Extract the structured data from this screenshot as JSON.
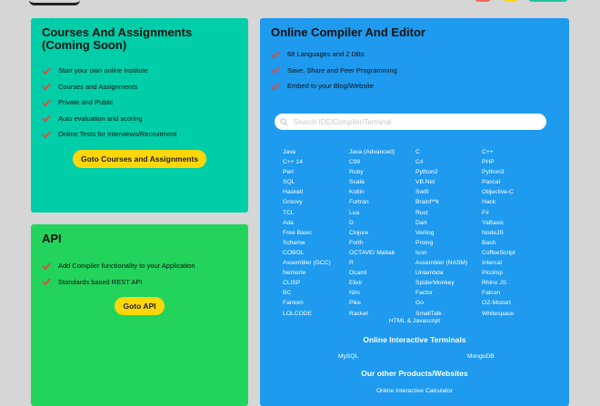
{
  "colors": {
    "page_bg": "#d6d6d6",
    "courses_card": "#00cea8",
    "api_card": "#22d45c",
    "compiler_card": "#1e9aee",
    "button_yellow": "#ffd60a",
    "check_red": "#e8453c",
    "header_red": "#f0685d",
    "header_yellow": "#ffd60a",
    "header_green": "#1fc79a"
  },
  "courses": {
    "title": "Courses And Assignments (Coming Soon)",
    "items": [
      "Start your own online Institute",
      "Courses and Assignments",
      "Private and Public",
      "Auto evaluation and scoring",
      "Online Tests for Interviews/Recruitment"
    ],
    "button": "Goto Courses and Assignments"
  },
  "api": {
    "title": "API",
    "items": [
      "Add Compiler functionality to your Application",
      "Standards based REST API"
    ],
    "button": "Goto API"
  },
  "compiler": {
    "title": "Online Compiler And Editor",
    "items": [
      "68 Languages and 2 DBs",
      "Save, Share and Peer Programming",
      "Embed to your Blog/Website"
    ],
    "search_placeholder": "Search IDE/Compiler/Terminal",
    "languages": [
      "Java",
      "Java (Advanced)",
      "C",
      "C++",
      "C++ 14",
      "C99",
      "C#",
      "PHP",
      "Perl",
      "Ruby",
      "Python2",
      "Python3",
      "SQL",
      "Scala",
      "VB.Net",
      "Pascal",
      "Haskell",
      "Kotlin",
      "Swift",
      "Objective-C",
      "Groovy",
      "Fortran",
      "Brainf**k",
      "Hack",
      "TCL",
      "Lua",
      "Rust",
      "F#",
      "Ada",
      "D",
      "Dart",
      "YaBasic",
      "Free Basic",
      "Clojure",
      "Verilog",
      "NodeJS",
      "Scheme",
      "Forth",
      "Prolog",
      "Bash",
      "COBOL",
      "OCTAVE/ Matlab",
      "Icon",
      "CoffeeScript",
      "Assembler (GCC)",
      "R",
      "Assembler (NASM)",
      "Intercal",
      "Nemerle",
      "Ocaml",
      "Unlambda",
      "Picolisp",
      "CLISP",
      "Elixir",
      "SpiderMonkey",
      "Rhino JS",
      "BC",
      "Nim",
      "Factor",
      "Falcon",
      "Fantom",
      "Pike",
      "Go",
      "OZ-Mozart",
      "LOLCODE",
      "Racket",
      "SmallTalk",
      "Whitespace"
    ],
    "html_js": "HTML & Javascript",
    "terminals_title": "Online Interactive Terminals",
    "terminals": [
      "MySQL",
      "MongoDB"
    ],
    "products_title": "Our other Products/Websites",
    "products": [
      "Online Interactive Calculator"
    ]
  }
}
